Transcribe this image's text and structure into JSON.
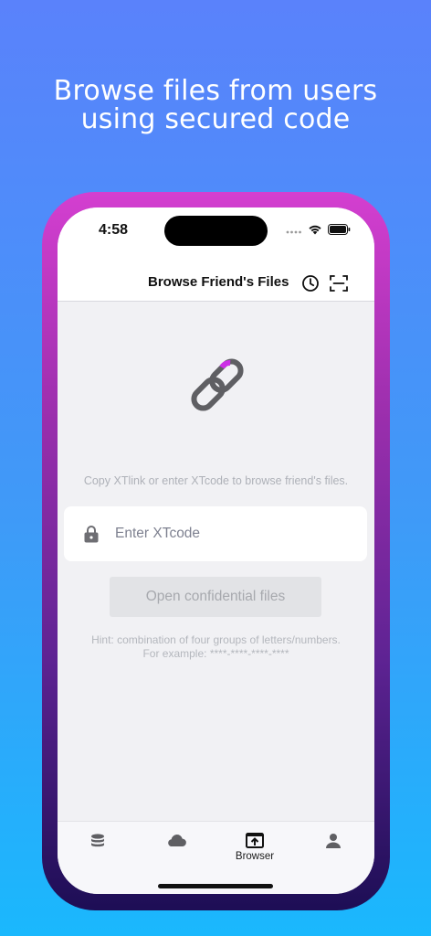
{
  "promo": {
    "headline_line1": "Browse files from users",
    "headline_line2": "using secured code"
  },
  "status_bar": {
    "time": "4:58",
    "icons": [
      "signal-dots-icon",
      "wifi-icon",
      "battery-icon"
    ]
  },
  "navbar": {
    "title": "Browse Friend's Files",
    "actions": [
      "history-clock-icon",
      "scan-icon"
    ]
  },
  "main": {
    "illustration": "chain-link-icon",
    "instruction": "Copy XTlink or enter XTcode to browse friend's files.",
    "code_input": {
      "placeholder": "Enter XTcode",
      "value": "",
      "icon": "lock-icon"
    },
    "open_button_label": "Open confidential files",
    "hint_line1": "Hint: combination of four groups of letters/numbers.",
    "hint_line2": "For example: ****-****-****-****"
  },
  "tabbar": {
    "items": [
      {
        "icon": "database-icon",
        "label": ""
      },
      {
        "icon": "cloud-icon",
        "label": ""
      },
      {
        "icon": "browser-icon",
        "label": "Browser",
        "selected": true
      },
      {
        "icon": "person-icon",
        "label": ""
      }
    ]
  },
  "colors": {
    "accent_pink": "#d43fd0",
    "link_accent": "#cc2fe6",
    "icon_gray": "#5f5f63"
  }
}
